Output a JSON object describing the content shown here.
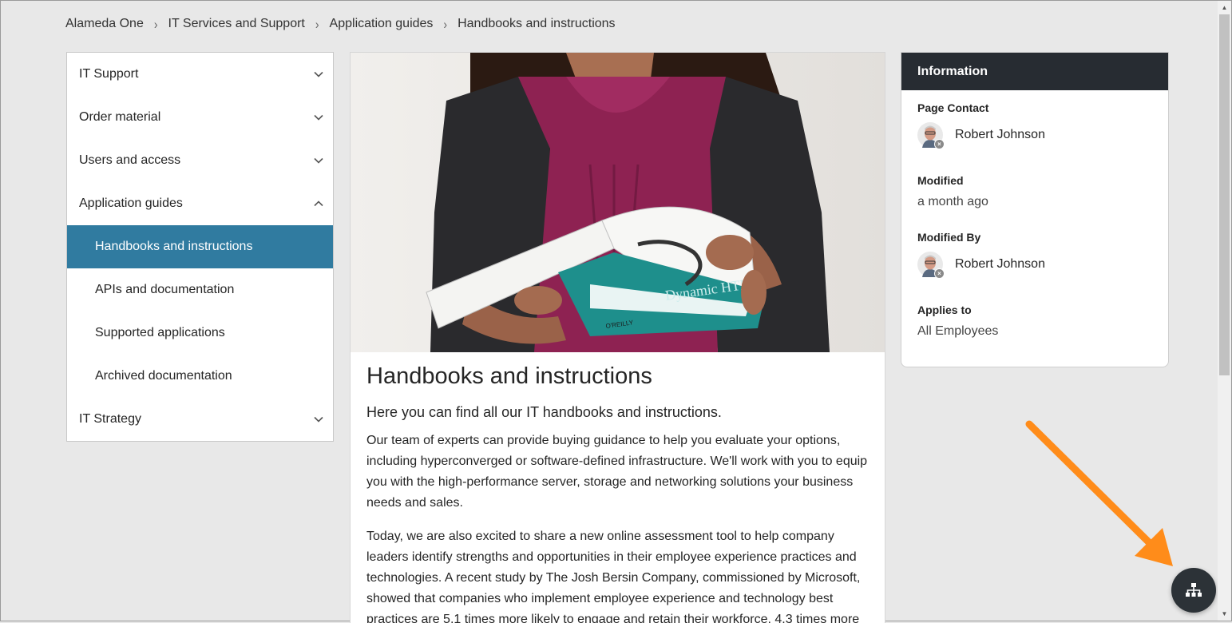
{
  "breadcrumb": [
    "Alameda One",
    "IT Services and Support",
    "Application guides",
    "Handbooks and instructions"
  ],
  "nav": {
    "items": [
      {
        "label": "IT Support"
      },
      {
        "label": "Order material"
      },
      {
        "label": "Users and access"
      },
      {
        "label": "Application guides"
      },
      {
        "label": "Handbooks and instructions"
      },
      {
        "label": "APIs and documentation"
      },
      {
        "label": "Supported applications"
      },
      {
        "label": "Archived documentation"
      },
      {
        "label": "IT Strategy"
      }
    ]
  },
  "article": {
    "title": "Handbooks and instructions",
    "lead": "Here you can find all our IT handbooks and instructions.",
    "paragraphs": [
      "Our team of experts can provide buying guidance to help you evaluate your options, including hyperconverged or software-defined infrastructure. We'll work with you to equip you with the high-performance server, storage and networking solutions your business needs and sales.",
      "Today, we are also excited to share a new online assessment tool to help company leaders identify strengths and opportunities in their employee experience practices and technologies. A recent study by The Josh Bersin Company, commissioned by Microsoft, showed that companies who implement employee experience and technology best practices are 5.1 times more likely to engage and retain their workforce, 4.3 times more"
    ],
    "book_title": "Dynamic HTML",
    "book_publisher": "O'REILLY"
  },
  "info": {
    "heading": "Information",
    "page_contact_label": "Page Contact",
    "page_contact_name": "Robert Johnson",
    "modified_label": "Modified",
    "modified_value": "a month ago",
    "modified_by_label": "Modified By",
    "modified_by_name": "Robert Johnson",
    "applies_to_label": "Applies to",
    "applies_to_value": "All Employees"
  },
  "colors": {
    "active_nav": "#307ba0",
    "info_header": "#272c32",
    "fab": "#2c3237",
    "annotation_arrow": "#ff8c1a"
  },
  "icons": {
    "nav_collapsed": "chevron-down-icon",
    "nav_expanded": "chevron-up-icon",
    "fab": "sitemap-icon"
  }
}
